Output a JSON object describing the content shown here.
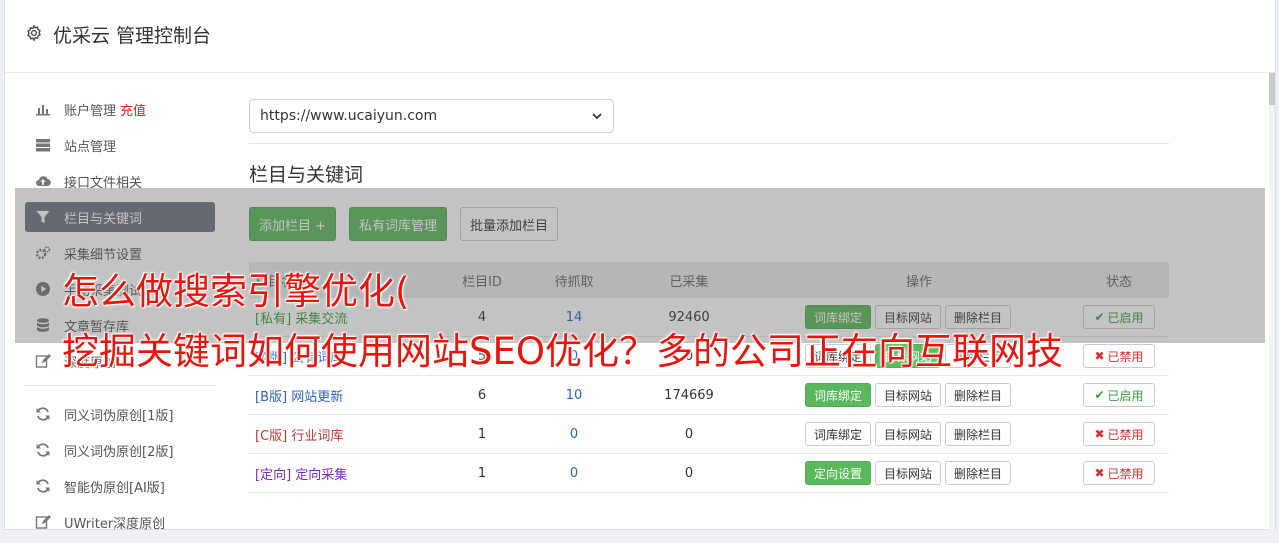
{
  "header": {
    "title": "优采云 管理控制台",
    "icon": "gear-icon"
  },
  "sidebar": {
    "group1": [
      {
        "label": "账户管理",
        "badge": "充值",
        "icon": "bar-chart-icon",
        "active": false
      },
      {
        "label": "站点管理",
        "icon": "server-icon",
        "active": false
      },
      {
        "label": "接口文件相关",
        "icon": "cloud-upload-icon",
        "active": false
      },
      {
        "label": "栏目与关键词",
        "icon": "filter-icon",
        "active": true
      },
      {
        "label": "采集细节设置",
        "icon": "cogs-icon",
        "active": false
      },
      {
        "label": "手动采集测试",
        "icon": "play-circle-icon",
        "active": false
      },
      {
        "label": "文章暂存库",
        "icon": "database-icon",
        "active": false
      },
      {
        "label": "深度原创",
        "icon": "edit-icon",
        "active": false
      }
    ],
    "group2": [
      {
        "label": "同义词伪原创[1版]",
        "icon": "refresh-icon"
      },
      {
        "label": "同义词伪原创[2版]",
        "icon": "refresh-icon"
      },
      {
        "label": "智能伪原创[AI版]",
        "icon": "refresh-icon"
      },
      {
        "label": "UWriter深度原创",
        "icon": "edit-icon"
      }
    ]
  },
  "main": {
    "site_select": {
      "value": "https://www.ucaiyun.com"
    },
    "section_title": "栏目与关键词",
    "buttons": {
      "add_column": "添加栏目 +",
      "private_lexicon": "私有词库管理",
      "batch_add": "批量添加栏目"
    },
    "table": {
      "headers": {
        "name": "栏目名称",
        "id": "栏目ID",
        "wait": "待抓取",
        "done": "已采集",
        "ops": "操作",
        "status": "状态"
      },
      "rows": [
        {
          "tag": "[私有]",
          "name": "采集交流",
          "id": "4",
          "wait": "14",
          "done": "92460",
          "op1": "词库绑定",
          "op2": "目标网站",
          "op3": "删除栏目",
          "status": "已启用"
        },
        {
          "tag": "[A版]",
          "name": "公有词库",
          "id": "5",
          "wait": "0",
          "done": "0",
          "op1": "词库绑定",
          "op2": "目标网站",
          "op3": "删除栏目",
          "status": "已禁用"
        },
        {
          "tag": "[B版]",
          "name": "网站更新",
          "id": "6",
          "wait": "10",
          "done": "174669",
          "op1": "词库绑定",
          "op2": "目标网站",
          "op3": "删除栏目",
          "status": "已启用"
        },
        {
          "tag": "[C版]",
          "name": "行业词库",
          "id": "1",
          "wait": "0",
          "done": "0",
          "op1": "词库绑定",
          "op2": "目标网站",
          "op3": "删除栏目",
          "status": "已禁用"
        },
        {
          "tag": "[定向]",
          "name": "定向采集",
          "id": "1",
          "wait": "0",
          "done": "0",
          "op1": "定向设置",
          "op2": "目标网站",
          "op3": "删除栏目",
          "status": "已禁用"
        }
      ]
    }
  },
  "banner": {
    "line1": "怎么做搜索引擎优化(",
    "line2": "挖掘关键词如何使用网站SEO优化？多的公司正在向互联网技"
  }
}
